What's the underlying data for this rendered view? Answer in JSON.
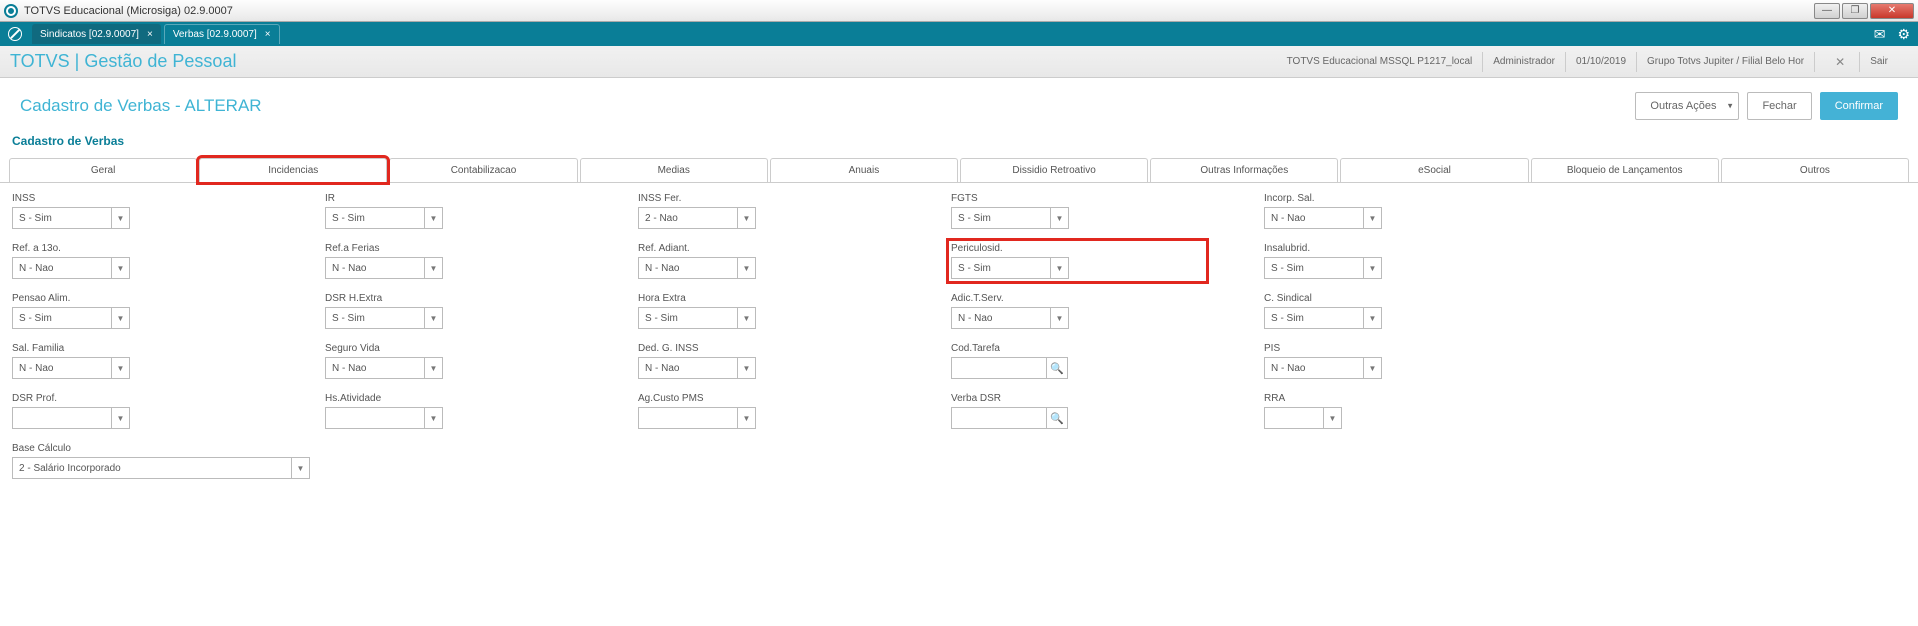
{
  "window": {
    "title": "TOTVS Educacional (Microsiga) 02.9.0007"
  },
  "tabstrip": {
    "tabs": [
      {
        "label": "Sindicatos [02.9.0007]"
      },
      {
        "label": "Verbas [02.9.0007]"
      }
    ]
  },
  "header": {
    "module_title": "TOTVS | Gestão de Pessoal",
    "env": "TOTVS Educacional MSSQL P1217_local",
    "user": "Administrador",
    "date": "01/10/2019",
    "company": "Grupo Totvs Jupiter / Filial Belo Hor",
    "exit": "Sair"
  },
  "page": {
    "title": "Cadastro de Verbas - ALTERAR",
    "section_title": "Cadastro de Verbas",
    "actions": {
      "other": "Outras Ações",
      "close": "Fechar",
      "confirm": "Confirmar"
    }
  },
  "form_tabs": {
    "geral": "Geral",
    "incidencias": "Incidencias",
    "contabilizacao": "Contabilizacao",
    "medias": "Medias",
    "anuais": "Anuais",
    "dissidio": "Dissidio Retroativo",
    "outras_info": "Outras Informações",
    "esocial": "eSocial",
    "bloqueio": "Bloqueio de Lançamentos",
    "outros": "Outros"
  },
  "fields": {
    "inss": {
      "label": "INSS",
      "value": "S - Sim"
    },
    "ir": {
      "label": "IR",
      "value": "S - Sim"
    },
    "inss_fer": {
      "label": "INSS Fer.",
      "value": "2 - Nao"
    },
    "fgts": {
      "label": "FGTS",
      "value": "S - Sim"
    },
    "incorp_sal": {
      "label": "Incorp. Sal.",
      "value": "N - Nao"
    },
    "ref_13o": {
      "label": "Ref. a 13o.",
      "value": "N - Nao"
    },
    "ref_ferias": {
      "label": "Ref.a Ferias",
      "value": "N - Nao"
    },
    "ref_adiant": {
      "label": "Ref. Adiant.",
      "value": "N - Nao"
    },
    "periculosid": {
      "label": "Periculosid.",
      "value": "S - Sim"
    },
    "insalubrid": {
      "label": "Insalubrid.",
      "value": "S - Sim"
    },
    "pensao_alim": {
      "label": "Pensao Alim.",
      "value": "S - Sim"
    },
    "dsr_hextra": {
      "label": "DSR H.Extra",
      "value": "S - Sim"
    },
    "hora_extra": {
      "label": "Hora Extra",
      "value": "S - Sim"
    },
    "adic_tserv": {
      "label": "Adic.T.Serv.",
      "value": "N - Nao"
    },
    "c_sindical": {
      "label": "C. Sindical",
      "value": "S - Sim"
    },
    "sal_familia": {
      "label": "Sal. Familia",
      "value": "N - Nao"
    },
    "seguro_vida": {
      "label": "Seguro Vida",
      "value": "N - Nao"
    },
    "ded_g_inss": {
      "label": "Ded. G. INSS",
      "value": "N - Nao"
    },
    "cod_tarefa": {
      "label": "Cod.Tarefa",
      "value": ""
    },
    "pis": {
      "label": "PIS",
      "value": "N - Nao"
    },
    "dsr_prof": {
      "label": "DSR Prof.",
      "value": ""
    },
    "hs_atividade": {
      "label": "Hs.Atividade",
      "value": ""
    },
    "ag_custo_pms": {
      "label": "Ag.Custo PMS",
      "value": ""
    },
    "verba_dsr": {
      "label": "Verba DSR",
      "value": ""
    },
    "rra": {
      "label": "RRA",
      "value": ""
    },
    "base_calculo": {
      "label": "Base Cálculo",
      "value": "2 - Salário Incorporado"
    }
  },
  "highlight": {
    "tab_color": "#e1281f"
  }
}
